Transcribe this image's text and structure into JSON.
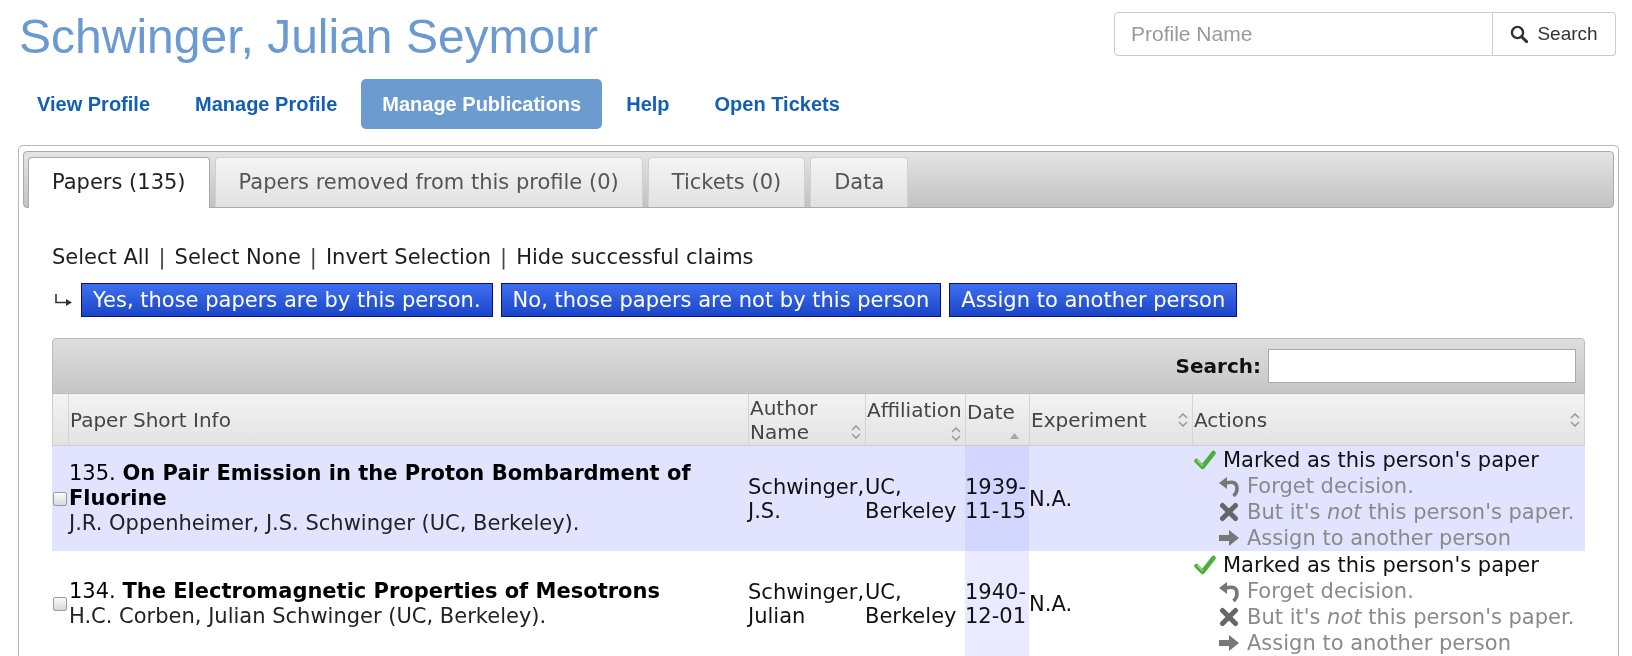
{
  "profile": {
    "name": "Schwinger, Julian Seymour"
  },
  "profile_search": {
    "placeholder": "Profile Name",
    "button": "Search"
  },
  "nav": [
    {
      "label": "View Profile",
      "selected": false
    },
    {
      "label": "Manage Profile",
      "selected": false
    },
    {
      "label": "Manage Publications",
      "selected": true
    },
    {
      "label": "Help",
      "selected": false
    },
    {
      "label": "Open Tickets",
      "selected": false
    }
  ],
  "tabs": [
    {
      "label": "Papers (135)",
      "selected": true
    },
    {
      "label": "Papers removed from this profile (0)",
      "selected": false
    },
    {
      "label": "Tickets (0)",
      "selected": false
    },
    {
      "label": "Data",
      "selected": false
    }
  ],
  "selection_links": [
    {
      "kind": "link",
      "text": "Select All"
    },
    {
      "kind": "separator",
      "text": "|"
    },
    {
      "kind": "link",
      "text": "Select None"
    },
    {
      "kind": "separator",
      "text": "|"
    },
    {
      "kind": "link",
      "text": "Invert Selection"
    },
    {
      "kind": "separator",
      "text": "|"
    },
    {
      "kind": "link",
      "text": "Hide successful claims"
    }
  ],
  "bulk_actions": [
    "Yes, those papers are by this person.",
    "No, those papers are not by this person",
    "Assign to another person"
  ],
  "table": {
    "search_label": "Search:",
    "columns": [
      {
        "label": "Paper Short Info",
        "sortable": false,
        "sorted": false
      },
      {
        "label": "Author Name",
        "sortable": true,
        "sorted": false
      },
      {
        "label": "Affiliation",
        "sortable": true,
        "sorted": false
      },
      {
        "label": "Date",
        "sortable": true,
        "sorted": true
      },
      {
        "label": "Experiment",
        "sortable": true,
        "sorted": false
      },
      {
        "label": "Actions",
        "sortable": true,
        "sorted": false
      }
    ],
    "rows": [
      {
        "checked": false,
        "title": "135. **On Pair Emission in the Proton Bombardment of Fluorine**",
        "authors": "J.R. Oppenheimer, J.S. Schwinger (UC, Berkeley).",
        "author_name": "Schwinger, J.S.",
        "affiliation": "UC, Berkeley",
        "date": "1939-11-15",
        "experiment": "N.A.",
        "actions": [
          {
            "kind": "status",
            "text": "Marked as this person's paper",
            "disabled": false
          },
          {
            "kind": "forget",
            "text": "Forget decision.",
            "disabled": true
          },
          {
            "kind": "reject",
            "text": "But it's *not* this person's paper.",
            "disabled": true
          },
          {
            "kind": "assign",
            "text": "Assign to another person",
            "disabled": true
          }
        ]
      },
      {
        "checked": false,
        "title": "134. **The Electromagnetic Properties of Mesotrons**",
        "authors": "H.C. Corben, Julian Schwinger (UC, Berkeley).",
        "author_name": "Schwinger, Julian",
        "affiliation": "UC, Berkeley",
        "date": "1940-12-01",
        "experiment": "N.A.",
        "actions": [
          {
            "kind": "status",
            "text": "Marked as this person's paper",
            "disabled": false
          },
          {
            "kind": "forget",
            "text": "Forget decision.",
            "disabled": true
          },
          {
            "kind": "reject",
            "text": "But it's *not* this person's paper.",
            "disabled": true
          },
          {
            "kind": "assign",
            "text": "Assign to another person",
            "disabled": true
          }
        ]
      }
    ]
  }
}
